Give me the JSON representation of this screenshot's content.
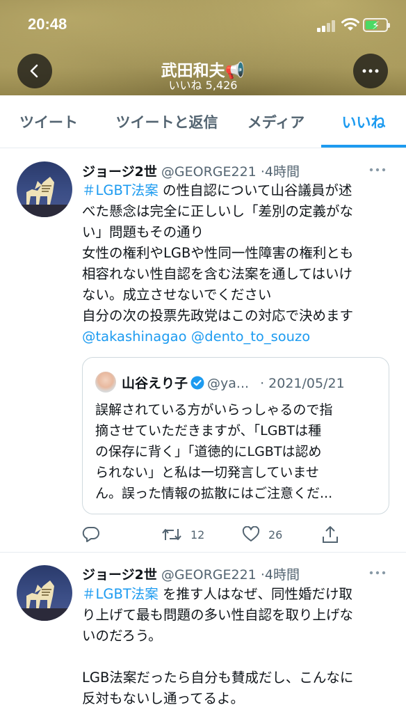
{
  "status_bar": {
    "time": "20:48"
  },
  "header": {
    "name": "武田和夫📢",
    "likes": "いいね 5,426"
  },
  "tabs": [
    {
      "label": "ツイート"
    },
    {
      "label": "ツイートと返信"
    },
    {
      "label": "メディア"
    },
    {
      "label": "いいね"
    }
  ],
  "active_tab": "いいね",
  "tweets": [
    {
      "name": "ジョージ2世",
      "handle": "@GEORGE221",
      "time": "·4時間",
      "hashtag": "＃LGBT法案",
      "text_after_hashtag": " の性自認について山谷議員が述",
      "lines": [
        "べた懸念は完全に正しいし「差別の定義がな",
        "い」問題もその通り",
        "女性の権利やLGBや性同一性障害の権利とも",
        "相容れない性自認を含む法案を通してはいけ",
        "ない。成立させないでください",
        "自分の次の投票先政党はこの対応で決めます"
      ],
      "mentions": "@takashinagao @dento_to_souzo",
      "quote": {
        "name": "山谷えり子",
        "handle": "@ya...",
        "date": "· 2021/05/21",
        "text": "誤解されている方がいらっしゃるので指\n摘させていただきますが、「LGBTは種\nの保存に背く」「道徳的にLGBTは認め\nられない」と私は一切発言していませ\nん。誤った情報の拡散にはご注意くだ..."
      },
      "retweets": "12",
      "likes": "26"
    },
    {
      "name": "ジョージ2世",
      "handle": "@GEORGE221",
      "time": "·4時間",
      "hashtag": "＃LGBT法案",
      "text_after_hashtag": " を推す人はなぜ、同性婚だけ取",
      "lines": [
        "り上げて最も問題の多い性自認を取り上げな",
        "いのだろう。",
        "",
        "LGB法案だったら自分も賛成だし、こんなに",
        "反対もないし通ってるよ。"
      ]
    }
  ]
}
